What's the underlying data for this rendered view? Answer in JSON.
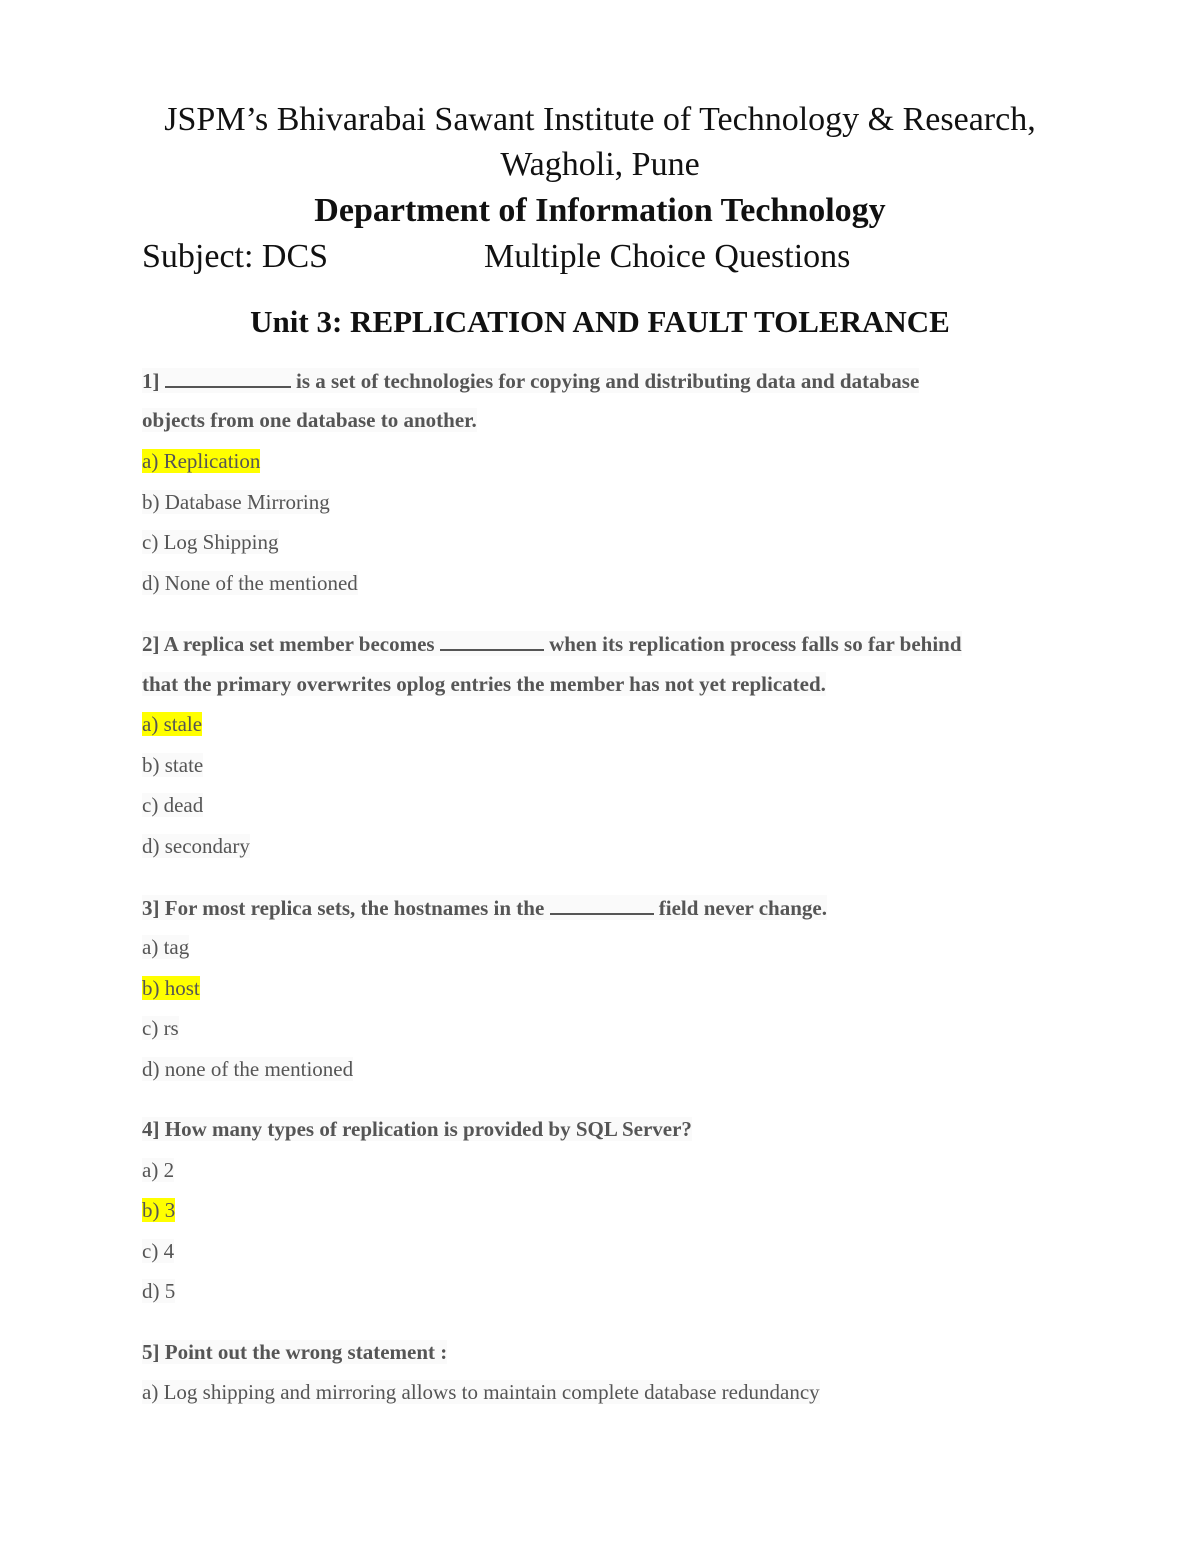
{
  "header": {
    "institute_line1": "JSPM’s Bhivarabai Sawant Institute of Technology & Research,",
    "institute_line2": "Wagholi, Pune",
    "department": "Department of Information Technology",
    "subject": "Subject: DCS",
    "doc_type": "Multiple Choice Questions",
    "unit_title": "Unit 3: REPLICATION AND FAULT TOLERANCE"
  },
  "highlight_color": "#ffff00",
  "questions": [
    {
      "number": "1]",
      "text_after_blank_line1": "is a set of technologies for copying and distributing data and database",
      "text_line2": "objects from one database to another.",
      "options": [
        "a) Replication",
        "b) Database Mirroring",
        "c) Log Shipping",
        "d) None of the mentioned"
      ],
      "answer_index": 0
    },
    {
      "number": "2]",
      "text_before_blank": "A replica set member becomes",
      "text_after_blank": "when its replication process falls so far behind",
      "text_line2": "that the primary overwrites oplog entries the member has not yet replicated.",
      "options": [
        "a) stale",
        "b) state",
        "c) dead",
        "d) secondary"
      ],
      "answer_index": 0
    },
    {
      "number": "3]",
      "text_before_blank": "For most replica sets, the hostnames in the",
      "text_after_blank": "field never change.",
      "options": [
        "a) tag",
        "b) host",
        "c) rs",
        "d) none of the mentioned"
      ],
      "answer_index": 1
    },
    {
      "number": "4]",
      "text": "How many types of replication is provided by SQL Server?",
      "options": [
        "a) 2",
        "b) 3",
        "c) 4",
        "d) 5"
      ],
      "answer_index": 1
    },
    {
      "number": "5]",
      "text": "Point out the wrong statement :",
      "options": [
        "a) Log shipping and mirroring allows to maintain complete database redundancy"
      ]
    }
  ]
}
